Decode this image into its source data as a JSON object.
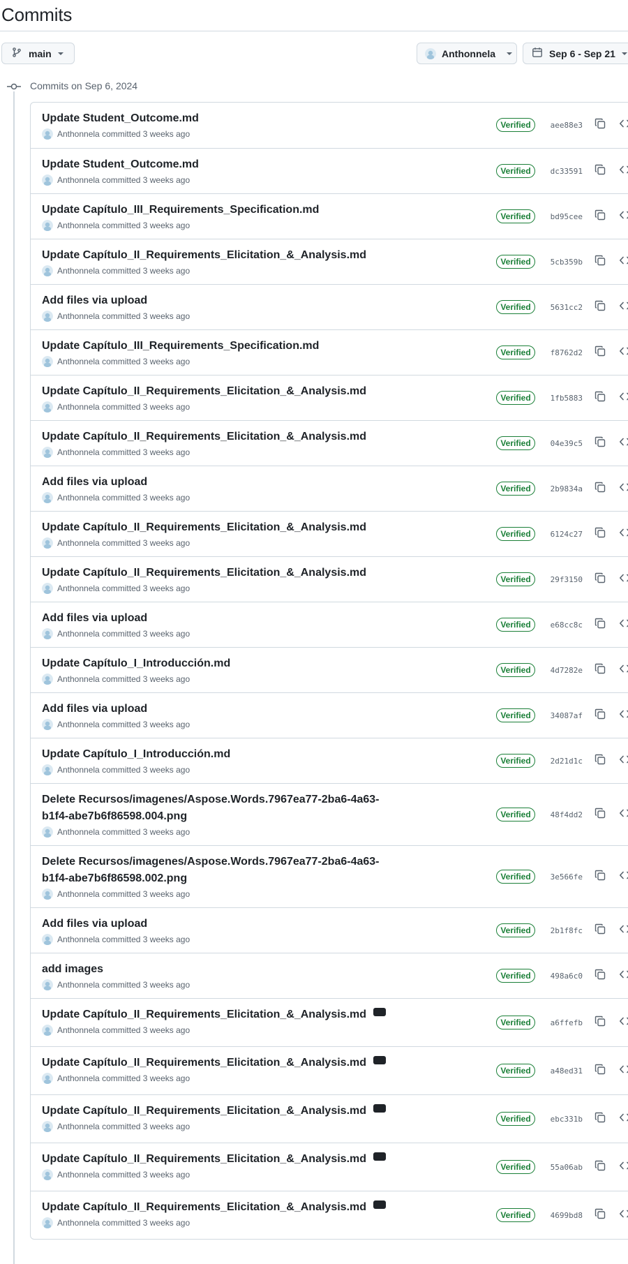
{
  "page_title": "Commits",
  "filters": {
    "branch": "main",
    "author": "Anthonnela",
    "date_range": "Sep 6 - Sep 21"
  },
  "day_heading": "Commits on Sep 6, 2024",
  "commit_labels": {
    "committed_text": "committed 3 weeks ago",
    "verified": "Verified"
  },
  "colors": {
    "verified_green": "#1a7f37",
    "border": "#d1d9e0",
    "muted_text": "#59636e"
  },
  "commits": [
    {
      "message": "Update Student_Outcome.md",
      "author": "Anthonnela",
      "time": "committed 3 weeks ago",
      "sha": "aee88e3",
      "badge": "Verified"
    },
    {
      "message": "Update Student_Outcome.md",
      "author": "Anthonnela",
      "time": "committed 3 weeks ago",
      "sha": "dc33591",
      "badge": "Verified"
    },
    {
      "message": "Update Capítulo_III_Requirements_Specification.md",
      "author": "Anthonnela",
      "time": "committed 3 weeks ago",
      "sha": "bd95cee",
      "badge": "Verified"
    },
    {
      "message": "Update Capítulo_II_Requirements_Elicitation_&_Analysis.md",
      "author": "Anthonnela",
      "time": "committed 3 weeks ago",
      "sha": "5cb359b",
      "badge": "Verified"
    },
    {
      "message": "Add files via upload",
      "author": "Anthonnela",
      "time": "committed 3 weeks ago",
      "sha": "5631cc2",
      "badge": "Verified"
    },
    {
      "message": "Update Capítulo_III_Requirements_Specification.md",
      "author": "Anthonnela",
      "time": "committed 3 weeks ago",
      "sha": "f8762d2",
      "badge": "Verified"
    },
    {
      "message": "Update Capítulo_II_Requirements_Elicitation_&_Analysis.md",
      "author": "Anthonnela",
      "time": "committed 3 weeks ago",
      "sha": "1fb5883",
      "badge": "Verified"
    },
    {
      "message": "Update Capítulo_II_Requirements_Elicitation_&_Analysis.md",
      "author": "Anthonnela",
      "time": "committed 3 weeks ago",
      "sha": "04e39c5",
      "badge": "Verified"
    },
    {
      "message": "Add files via upload",
      "author": "Anthonnela",
      "time": "committed 3 weeks ago",
      "sha": "2b9834a",
      "badge": "Verified"
    },
    {
      "message": "Update Capítulo_II_Requirements_Elicitation_&_Analysis.md",
      "author": "Anthonnela",
      "time": "committed 3 weeks ago",
      "sha": "6124c27",
      "badge": "Verified"
    },
    {
      "message": "Update Capítulo_II_Requirements_Elicitation_&_Analysis.md",
      "author": "Anthonnela",
      "time": "committed 3 weeks ago",
      "sha": "29f3150",
      "badge": "Verified"
    },
    {
      "message": "Add files via upload",
      "author": "Anthonnela",
      "time": "committed 3 weeks ago",
      "sha": "e68cc8c",
      "badge": "Verified"
    },
    {
      "message": "Update Capítulo_I_Introducción.md",
      "author": "Anthonnela",
      "time": "committed 3 weeks ago",
      "sha": "4d7282e",
      "badge": "Verified"
    },
    {
      "message": "Add files via upload",
      "author": "Anthonnela",
      "time": "committed 3 weeks ago",
      "sha": "34087af",
      "badge": "Verified"
    },
    {
      "message": "Update Capítulo_I_Introducción.md",
      "author": "Anthonnela",
      "time": "committed 3 weeks ago",
      "sha": "2d21d1c",
      "badge": "Verified"
    },
    {
      "message": "Delete Recursos/imagenes/Aspose.Words.7967ea77-2ba6-4a63-b1f4-abe7b6f86598.004.png",
      "author": "Anthonnela",
      "time": "committed 3 weeks ago",
      "sha": "48f4dd2",
      "badge": "Verified"
    },
    {
      "message": "Delete Recursos/imagenes/Aspose.Words.7967ea77-2ba6-4a63-b1f4-abe7b6f86598.002.png",
      "author": "Anthonnela",
      "time": "committed 3 weeks ago",
      "sha": "3e566fe",
      "badge": "Verified"
    },
    {
      "message": "Add files via upload",
      "author": "Anthonnela",
      "time": "committed 3 weeks ago",
      "sha": "2b1f8fc",
      "badge": "Verified"
    },
    {
      "message": "add images",
      "author": "Anthonnela",
      "time": "committed 3 weeks ago",
      "sha": "498a6c0",
      "badge": "Verified"
    },
    {
      "message": "Update Capítulo_II_Requirements_Elicitation_&_Analysis.md",
      "author": "Anthonnela",
      "time": "committed 3 weeks ago",
      "sha": "a6ffefb",
      "badge": "Verified"
    },
    {
      "message": "Update Capítulo_II_Requirements_Elicitation_&_Analysis.md",
      "author": "Anthonnela",
      "time": "committed 3 weeks ago",
      "sha": "a48ed31",
      "badge": "Verified"
    },
    {
      "message": "Update Capítulo_II_Requirements_Elicitation_&_Analysis.md",
      "author": "Anthonnela",
      "time": "committed 3 weeks ago",
      "sha": "ebc331b",
      "badge": "Verified"
    },
    {
      "message": "Update Capítulo_II_Requirements_Elicitation_&_Analysis.md",
      "author": "Anthonnela",
      "time": "committed 3 weeks ago",
      "sha": "55a06ab",
      "badge": "Verified"
    },
    {
      "message": "Update Capítulo_II_Requirements_Elicitation_&_Analysis.md",
      "author": "Anthonnela",
      "time": "committed 3 weeks ago",
      "sha": "4699bd8",
      "badge": "Verified"
    }
  ]
}
